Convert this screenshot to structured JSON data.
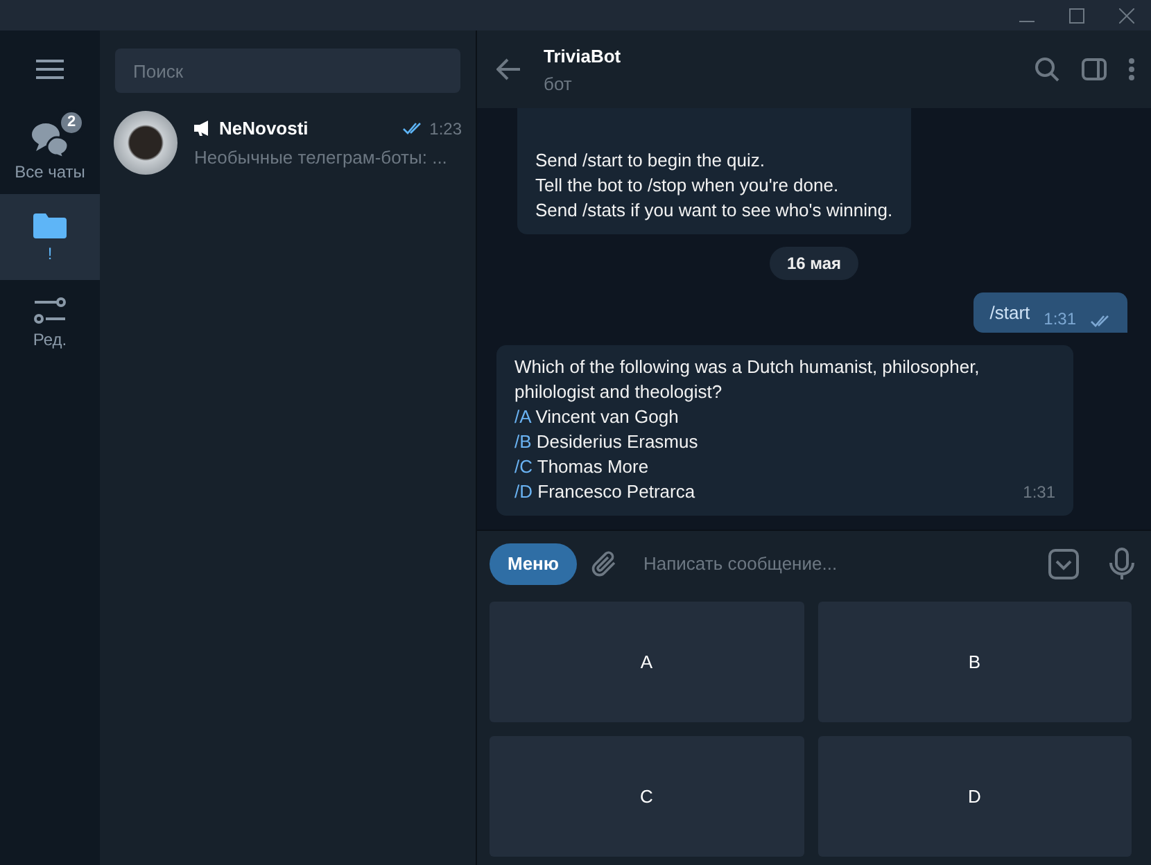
{
  "rail": {
    "items": [
      {
        "kind": "chats",
        "label": "Все чаты",
        "badge": "2",
        "selected": false
      },
      {
        "kind": "folder",
        "label": "!",
        "selected": true
      },
      {
        "kind": "edit",
        "label": "Ред.",
        "selected": false
      }
    ]
  },
  "search": {
    "placeholder": "Поиск"
  },
  "chats": [
    {
      "kind": "channel",
      "name": "NeNovosti",
      "time": "1:23",
      "preview": "Необычные телеграм-боты: ...",
      "read": true,
      "selected": false
    }
  ],
  "chat_header": {
    "title": "TriviaBot",
    "subtitle": "бот"
  },
  "messages": [
    {
      "kind": "incoming",
      "lines": [
        "Send /start to begin the quiz.",
        "Tell the bot to /stop when you're done.",
        "Send /stats if you want to see who's winning."
      ]
    },
    {
      "kind": "date",
      "text": "16 мая"
    },
    {
      "kind": "outgoing",
      "text": "/start",
      "time": "1:31",
      "read": true
    },
    {
      "kind": "incoming",
      "text": "Which of the following was a Dutch humanist, philosopher, philologist and theologist?",
      "options": [
        {
          "command": "/A",
          "text": "Vincent van Gogh"
        },
        {
          "command": "/B",
          "text": "Desiderius Erasmus"
        },
        {
          "command": "/C",
          "text": "Thomas More"
        },
        {
          "command": "/D",
          "text": "Francesco Petrarca"
        }
      ],
      "time": "1:31"
    }
  ],
  "composer": {
    "menu_button": "Меню",
    "placeholder": "Написать сообщение..."
  },
  "keyboard": [
    "A",
    "B",
    "C",
    "D"
  ]
}
